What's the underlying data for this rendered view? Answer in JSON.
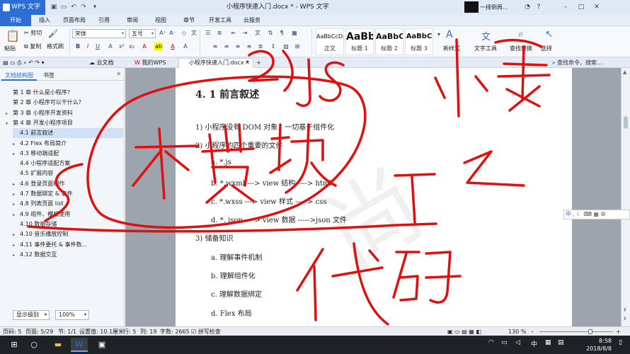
{
  "titlebar": {
    "app_name": "WPS 文字",
    "document_title": "小程序快速入门.docx * - WPS 文字",
    "notification": "一择倒再...",
    "window_controls": [
      "minimize-icon",
      "maximize-icon",
      "close-icon"
    ]
  },
  "menu": {
    "tabs": [
      "开始",
      "插入",
      "页面布局",
      "引用",
      "审阅",
      "视图",
      "章节",
      "开发工具",
      "云服务"
    ],
    "active": "开始"
  },
  "ribbon": {
    "paste": "粘贴",
    "cut": "剪切",
    "copy": "复制",
    "format_painter": "格式刷",
    "font_family": "宋体",
    "font_size": "五号",
    "styles": [
      {
        "preview": "AaBbCcDd",
        "label": "正文"
      },
      {
        "preview": "AaBb",
        "label": "标题 1"
      },
      {
        "preview": "AaBbC",
        "label": "标题 2"
      },
      {
        "preview": "AaBbC",
        "label": "标题 3"
      }
    ],
    "new_style": "新样式",
    "text_tools": "文字工具",
    "find_replace": "查找替换",
    "select": "选择"
  },
  "tabbar": {
    "cloud_docs": "云文档",
    "my_wps": "我的WPS",
    "doc_tab": "小程序快速入门.docx *",
    "search_placeholder": "查找命令、搜索..."
  },
  "leftpane": {
    "tab_outline": "文档结构图",
    "tab_bookmarks": "书签",
    "items": [
      {
        "label": "第 1 章  什么是小程序?",
        "level": 0,
        "expander": ""
      },
      {
        "label": "第 2 章  小程序可以干什么?",
        "level": 0,
        "expander": ""
      },
      {
        "label": "第 3 章  小程序开发资料",
        "level": 0,
        "expander": "▸"
      },
      {
        "label": "第 4 章  开发小程序项目",
        "level": 0,
        "expander": "▾"
      },
      {
        "label": "4.1  前言叙述",
        "level": 1,
        "expander": "",
        "selected": true
      },
      {
        "label": "4.2  Flex 布局简介",
        "level": 1,
        "expander": "▸"
      },
      {
        "label": "4.3  移动端适配",
        "level": 1,
        "expander": "▸"
      },
      {
        "label": "4.4  小程序适配方案",
        "level": 1,
        "expander": ""
      },
      {
        "label": "4.5  扩展内容",
        "level": 1,
        "expander": ""
      },
      {
        "label": "4.6  登录页面制作",
        "level": 1,
        "expander": "▸"
      },
      {
        "label": "4.7  数据绑定 & 事件",
        "level": 1,
        "expander": "▸"
      },
      {
        "label": "4.8  列表页面 list",
        "level": 1,
        "expander": "▸"
      },
      {
        "label": "4.9  组件、模板使用",
        "level": 1,
        "expander": "▸"
      },
      {
        "label": "4.10  数据存储",
        "level": 1,
        "expander": ""
      },
      {
        "label": "4.10  音乐播放控制",
        "level": 1,
        "expander": "▸"
      },
      {
        "label": "4.11  事件委托 & 事件数...",
        "level": 1,
        "expander": "▸"
      },
      {
        "label": "4.12  数据交互",
        "level": 1,
        "expander": "▸"
      }
    ],
    "display_level": "显示级别",
    "zoom": "100%"
  },
  "document": {
    "heading": "4. 1  前言叙述",
    "lines": [
      {
        "text": "1)  小程序没有 DOM 对象，一切基于组件化",
        "indent": 0
      },
      {
        "text": "2)  小程序的四个重要的文件",
        "indent": 0
      },
      {
        "text": "a.    *.js",
        "indent": 1
      },
      {
        "text": "b.    *.wxml ---> view 结构 ----> html",
        "indent": 1
      },
      {
        "text": "c.    *.wxss ---> view 样式 -----> css",
        "indent": 1
      },
      {
        "text": "d.    *. json ----> view  数据  ----->json  文件",
        "indent": 1
      },
      {
        "text": "3)  储备知识",
        "indent": 0
      },
      {
        "text": "a.    理解事件机制",
        "indent": 1
      },
      {
        "text": "b.    理解组件化",
        "indent": 1
      },
      {
        "text": "c.    理解数据绑定",
        "indent": 1
      },
      {
        "text": "d.    Flex  布局",
        "indent": 1
      }
    ]
  },
  "ime": "中 ,",
  "status": {
    "page": "页码: 5",
    "pages": "页面: 5/29",
    "section": "节: 1/1",
    "setting": "设置值: 10.1厘米",
    "row": "行: 5",
    "col": "列: 19",
    "words": "字数: 2665",
    "spell": "拼写检查",
    "zoom": "130 %"
  },
  "taskbar": {
    "time": "8:58",
    "date": "2018/8/8",
    "lang": "中"
  },
  "colors": {
    "brand": "#2c6ed5",
    "ink": "#e01010"
  }
}
